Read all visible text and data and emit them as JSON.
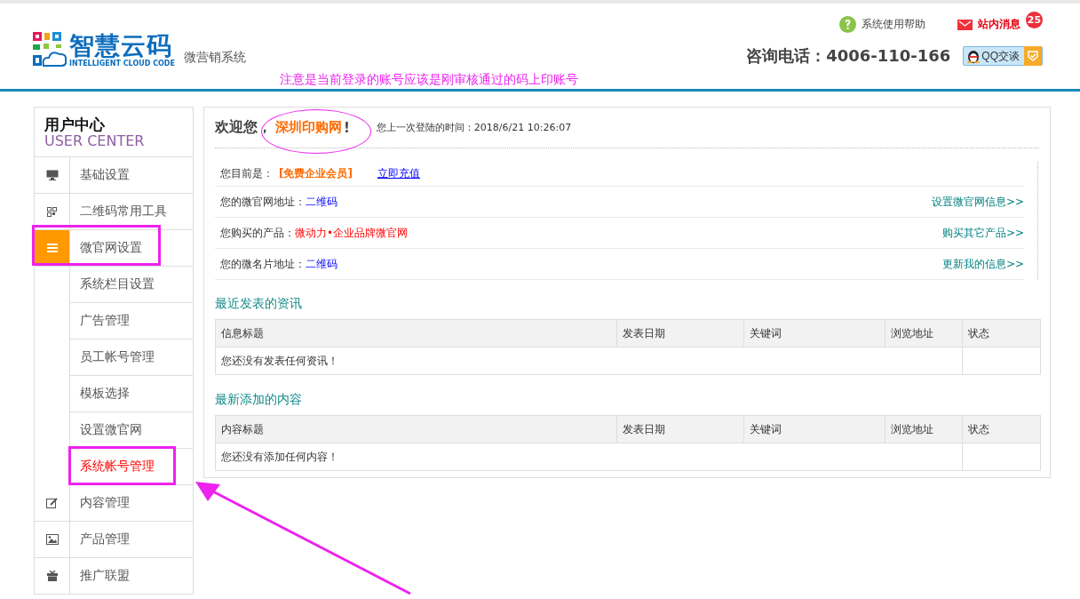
{
  "header": {
    "logo_title": "智慧云码",
    "logo_subtitle": "INTELLIGENT CLOUD CODE",
    "system_name": "微营销系统",
    "help_link": "系统使用帮助",
    "messages": {
      "label": "站内消息",
      "count": "25"
    },
    "hotline": "咨询电话：4006-110-166",
    "qq_button": "QQ交谈"
  },
  "annotation_note": "注意是当前登录的账号应该是刚审核通过的码上印账号",
  "sidebar": {
    "title": "用户中心",
    "subtitle": "USER CENTER",
    "items": [
      {
        "label": "基础设置",
        "selected": false,
        "highlighted": false
      },
      {
        "label": "二维码常用工具",
        "selected": false,
        "highlighted": false
      },
      {
        "label": "微官网设置",
        "selected": true,
        "highlighted": true,
        "children": [
          {
            "label": "系统栏目设置",
            "selected": false,
            "highlighted": false
          },
          {
            "label": "广告管理",
            "selected": false,
            "highlighted": false
          },
          {
            "label": "员工帐号管理",
            "selected": false,
            "highlighted": false
          },
          {
            "label": "模板选择",
            "selected": false,
            "highlighted": false
          },
          {
            "label": "设置微官网",
            "selected": false,
            "highlighted": false
          },
          {
            "label": "系统帐号管理",
            "selected": true,
            "highlighted": true
          }
        ]
      },
      {
        "label": "内容管理",
        "selected": false,
        "highlighted": false
      },
      {
        "label": "产品管理",
        "selected": false,
        "highlighted": false
      },
      {
        "label": "推广联盟",
        "selected": false,
        "highlighted": false
      }
    ]
  },
  "welcome": {
    "greeting": "欢迎您，",
    "name": "深圳印购网",
    "suffix": "!",
    "name_highlighted": true,
    "last_login_label": "您上一次登陆的时间：",
    "last_login": "2018/6/21 10:26:07"
  },
  "info_rows": [
    {
      "kind": "membership",
      "label": "您目前是：",
      "value": "[免费企业会员]",
      "action": "立即充值"
    },
    {
      "kind": "link",
      "label": "您的微官网地址：",
      "value": "二维码",
      "action": "设置微官网信息>>"
    },
    {
      "kind": "product",
      "label": "您购买的产品：",
      "value": "微动力•企业品牌微官网",
      "action": "购买其它产品>>"
    },
    {
      "kind": "link",
      "label": "您的微名片地址：",
      "value": "二维码",
      "action": "更新我的信息>>"
    }
  ],
  "sections": [
    {
      "title": "最近发表的资讯",
      "columns": [
        "信息标题",
        "发表日期",
        "关键词",
        "浏览地址",
        "状态"
      ],
      "empty_message": "您还没有发表任何资讯！"
    },
    {
      "title": "最新添加的内容",
      "columns": [
        "内容标题",
        "发表日期",
        "关键词",
        "浏览地址",
        "状态"
      ],
      "empty_message": "您还没有添加任何内容！"
    }
  ]
}
